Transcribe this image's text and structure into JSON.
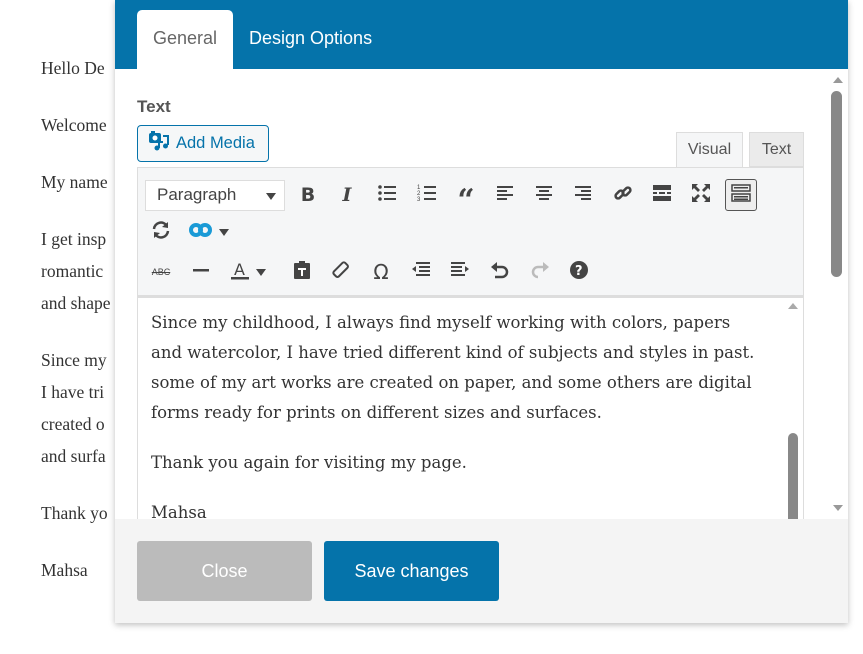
{
  "background_page": {
    "paragraphs": [
      "Hello De",
      "Welcome",
      "My name",
      "I get insp",
      "romantic",
      "and shape",
      "Since my",
      "I have tri",
      "created o",
      "and surfa",
      "Thank yo",
      "Mahsa"
    ]
  },
  "modal": {
    "tabs": [
      {
        "label": "General",
        "active": true
      },
      {
        "label": "Design Options",
        "active": false
      }
    ],
    "field_label": "Text",
    "add_media_label": "Add Media",
    "editor_tabs": [
      {
        "label": "Visual",
        "active": true
      },
      {
        "label": "Text",
        "active": false
      }
    ],
    "format_select": {
      "value": "Paragraph"
    },
    "toolbar_row1": [
      "bold-icon",
      "italic-icon",
      "bullet-list-icon",
      "numbered-list-icon",
      "blockquote-icon",
      "align-left-icon",
      "align-center-icon",
      "align-right-icon",
      "link-icon",
      "read-more-icon",
      "fullscreen-icon",
      "toolbar-toggle-icon"
    ],
    "toolbar_row2": [
      "refresh-icon",
      "infinity-icon"
    ],
    "toolbar_row3": [
      "strikethrough-icon",
      "horizontal-line-icon",
      "text-color-icon",
      "paste-text-icon",
      "clear-formatting-icon",
      "special-character-icon",
      "outdent-icon",
      "indent-icon",
      "undo-icon",
      "redo-icon",
      "help-icon"
    ],
    "content": [
      "Since my childhood, I always find myself working with colors, papers and watercolor, I have tried different kind of subjects and styles in past.  some of my art works are created on paper, and some others are digital forms ready for prints on different sizes and surfaces.",
      "Thank you again for visiting my page.",
      "Mahsa"
    ],
    "buttons": {
      "close": "Close",
      "save": "Save changes"
    }
  },
  "colors": {
    "accent": "#0573aa",
    "close_button": "#bbbbbb"
  }
}
